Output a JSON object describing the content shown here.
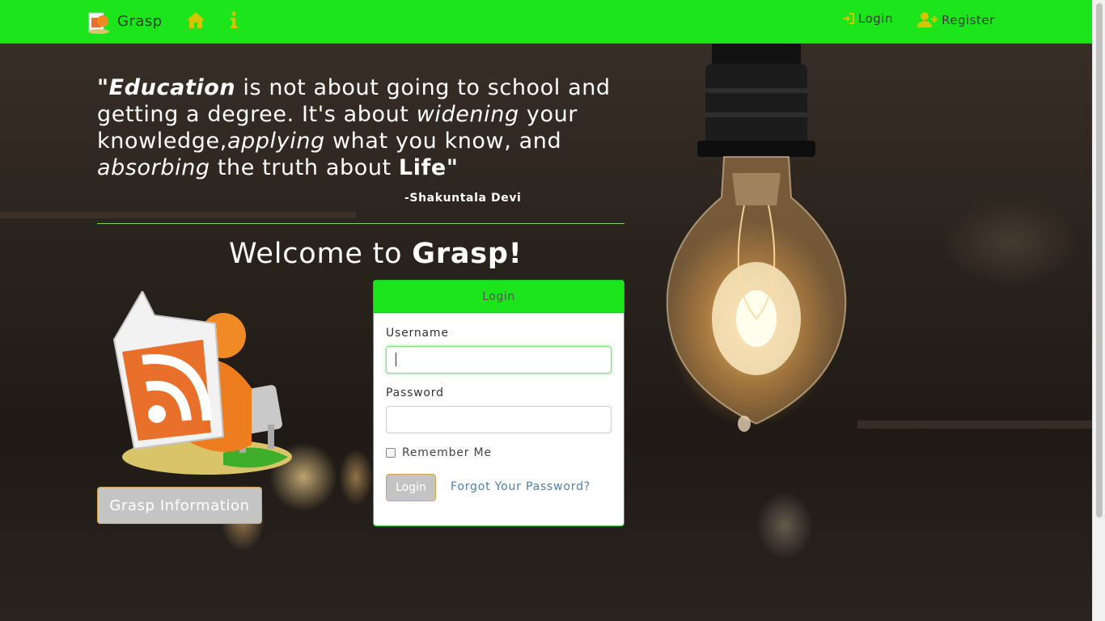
{
  "nav": {
    "brand": "Grasp",
    "home_icon": "home-icon",
    "info_icon": "info-icon",
    "login": "Login",
    "register": "Register"
  },
  "quote": {
    "p1": "\"Education",
    "p2": " is not about going to school and getting a degree. It's about ",
    "p3": "widening",
    "p4": " your knowledge,",
    "p5": "applying",
    "p6": " what you know, and ",
    "p7": "absorbing",
    "p8": " the truth about ",
    "p9": "Life\"",
    "author": "-Shakuntala Devi"
  },
  "welcome": {
    "prefix": "Welcome to ",
    "brand": "Grasp!"
  },
  "info_button": "Grasp Information",
  "login_panel": {
    "title": "Login",
    "username_label": "Username",
    "username_value": "",
    "password_label": "Password",
    "password_value": "",
    "remember": "Remember Me",
    "submit": "Login",
    "forgot": "Forgot Your Password?"
  },
  "colors": {
    "accent": "#1ce51c",
    "link": "#4a7fae",
    "icon": "#d6c400"
  }
}
